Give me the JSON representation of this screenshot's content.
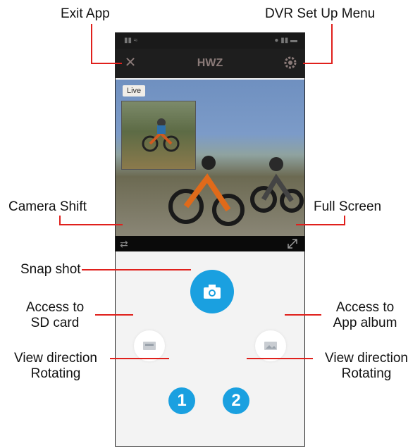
{
  "callouts": {
    "exit_app": "Exit App",
    "dvr_menu": "DVR Set Up Menu",
    "camera_shift": "Camera Shift",
    "full_screen": "Full Screen",
    "snap_shot": "Snap shot",
    "sd_card_line1": "Access to",
    "sd_card_line2": "SD card",
    "app_album_line1": "Access to",
    "app_album_line2": "App album",
    "view_left_line1": "View direction",
    "view_left_line2": "Rotating",
    "view_right_line1": "View direction",
    "view_right_line2": "Rotating"
  },
  "app": {
    "title": "HWZ",
    "live_label": "Live",
    "rotate_1": "1",
    "rotate_2": "2"
  },
  "colors": {
    "accent": "#1aa0e0",
    "callout_line": "#e0201c",
    "titlebar": "#1e1e1e"
  },
  "icons": [
    "close-icon",
    "gear-icon",
    "camera-shift-icon",
    "fullscreen-icon",
    "camera-icon",
    "sd-card-icon",
    "album-icon"
  ]
}
